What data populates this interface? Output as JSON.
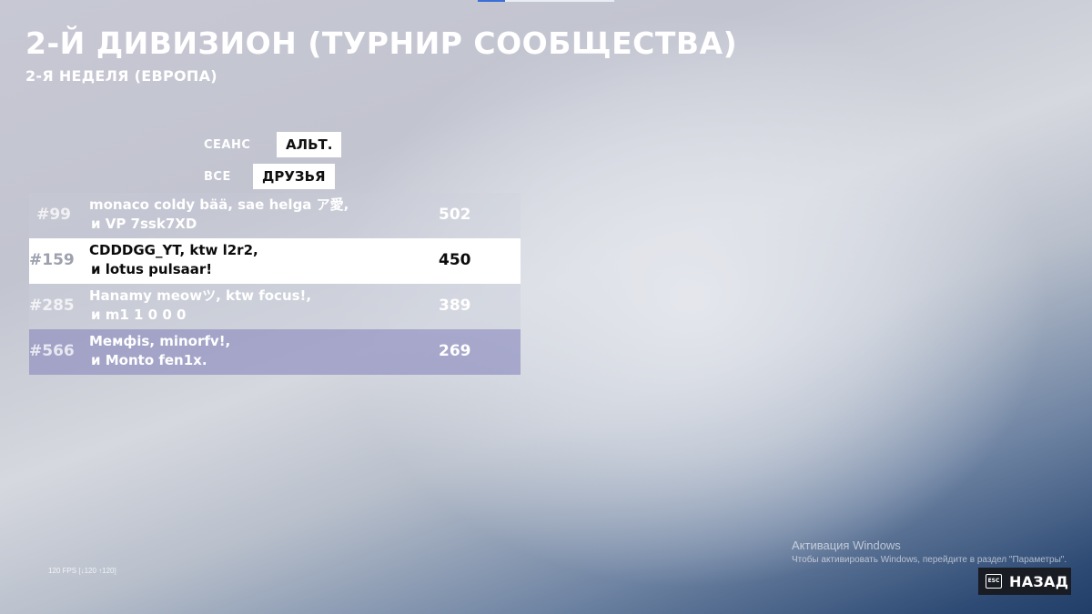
{
  "header": {
    "title": "2-Й ДИВИЗИОН (ТУРНИР СООБЩЕСТВА)",
    "subtitle": "2-Я НЕДЕЛЯ (ЕВРОПА)"
  },
  "filters": {
    "session_label": "СЕАНС",
    "session_value": "АЛЬТ.",
    "scope_label": "ВСЕ",
    "scope_value": "ДРУЗЬЯ"
  },
  "leaderboard": [
    {
      "rank": "#99",
      "names_line1": "monaco coldy bää, sae helga ア愛,",
      "names_line2": "и VP 7ssk7XD",
      "score": "502",
      "highlighted": false
    },
    {
      "rank": "#159",
      "names_line1": "CDDDGG_YT, ktw l2r2,",
      "names_line2": "и lotus pulsaar!",
      "score": "450",
      "highlighted": true
    },
    {
      "rank": "#285",
      "names_line1": "Hanamy meowツ, ktw focus!,",
      "names_line2": "и m1 1 0 0 0",
      "score": "389",
      "highlighted": false
    },
    {
      "rank": "#566",
      "names_line1": "Мемфis, minorfv!,",
      "names_line2": "и Monto fen1x.",
      "score": "269",
      "highlighted": false
    }
  ],
  "windows_activation": {
    "heading": "Активация Windows",
    "text": "Чтобы активировать Windows, перейдите в раздел \"Параметры\"."
  },
  "fps": "120 FPS [↓120 ↑120]",
  "back_button": {
    "key": "ESC",
    "label": "НАЗАД"
  }
}
